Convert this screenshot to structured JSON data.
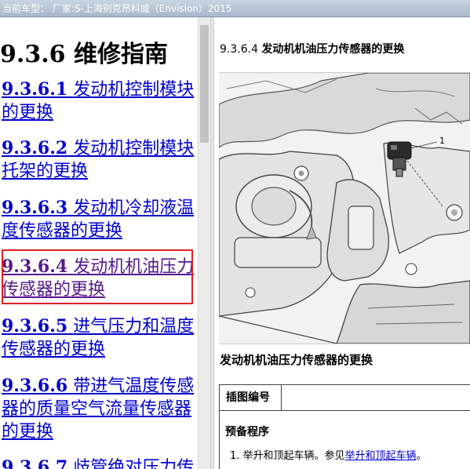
{
  "header": {
    "vehicle": "当前车型： 厂家:S-上海别克昂科威（Envision）2015"
  },
  "left": {
    "title": "9.3.6 维修指南",
    "links": [
      {
        "number": "9.3.6.1",
        "label": "发动机控制模块的更换"
      },
      {
        "number": "9.3.6.2",
        "label": "发动机控制模块托架的更换"
      },
      {
        "number": "9.3.6.3",
        "label": "发动机冷却液温度传感器的更换"
      },
      {
        "number": "9.3.6.4",
        "label": "发动机机油压力传感器的更换"
      },
      {
        "number": "9.3.6.5",
        "label": "进气压力和温度传感器的更换"
      },
      {
        "number": "9.3.6.6",
        "label": "带进气温度传感器的质量空气流量传感器的更换"
      },
      {
        "number": "9.3.6.7",
        "label": "歧管绝对压力传"
      }
    ]
  },
  "right": {
    "section_number": "9.3.6.4",
    "section_title": "发动机机油压力传感器的更换",
    "figure": {
      "callout": "1"
    },
    "caption": "发动机机油压力传感器的更换",
    "table_header": "插图编号",
    "prep_title": "预备程序",
    "step_prefix": "1. 举升和顶起车辆。参见",
    "step_link": "举升和顶起车辆",
    "step_suffix": "。"
  }
}
